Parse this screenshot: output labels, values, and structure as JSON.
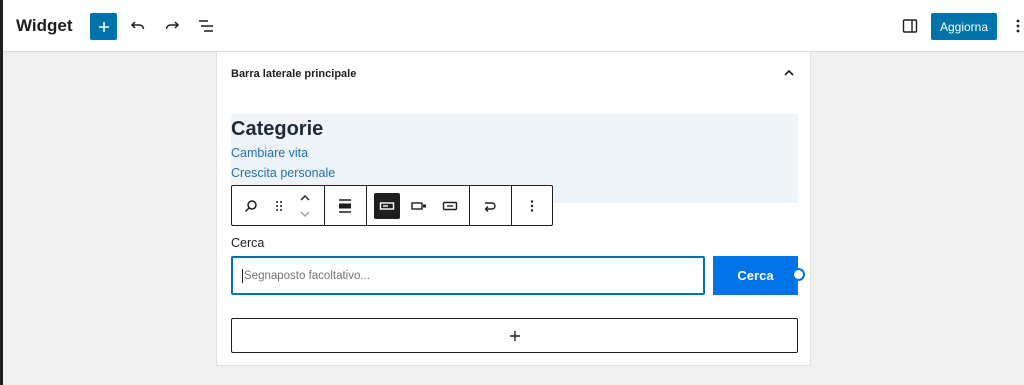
{
  "header": {
    "title": "Widget",
    "update_label": "Aggiorna"
  },
  "sidebar_area": {
    "title": "Barra laterale principale"
  },
  "categories_block": {
    "title": "Categorie",
    "links": [
      "Cambiare vita",
      "Crescita personale"
    ]
  },
  "search_block": {
    "label": "Cerca",
    "placeholder": "Segnaposto facoltativo...",
    "button_label": "Cerca"
  },
  "icons": {
    "add": "plus-icon",
    "undo": "undo-icon",
    "redo": "redo-icon",
    "list_view": "list-view-icon",
    "settings": "sidebar-toggle-icon",
    "options": "more-vertical-icon",
    "collapse": "chevron-up-icon"
  },
  "colors": {
    "accent": "#0073aa",
    "search_button": "#0073e6",
    "link": "#2271b1",
    "block_bg": "#eef3f8"
  }
}
